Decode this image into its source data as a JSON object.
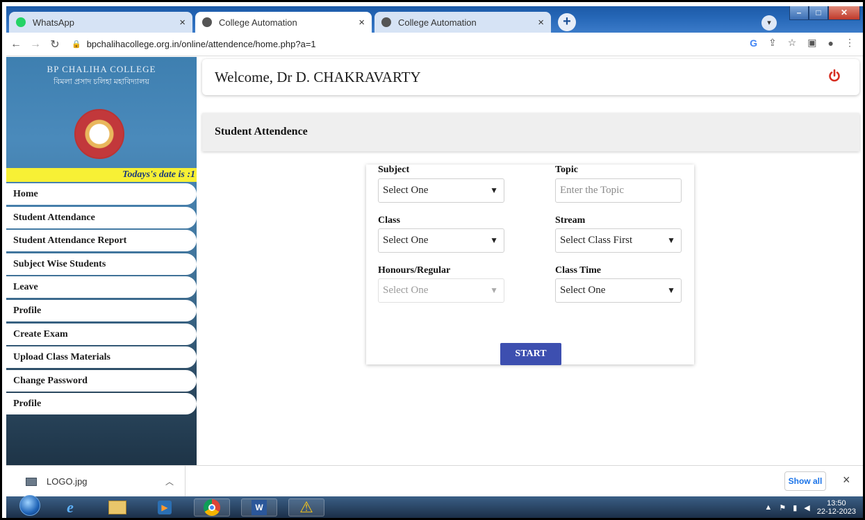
{
  "browser": {
    "tabs": [
      {
        "label": "WhatsApp",
        "favicon_color": "#25d366",
        "active": false
      },
      {
        "label": "College Automation",
        "favicon_color": "#555555",
        "active": true
      },
      {
        "label": "College Automation",
        "favicon_color": "#555555",
        "active": false
      }
    ],
    "url": "bpchalihacollege.org.in/online/attendence/home.php?a=1",
    "new_tab_symbol": "+",
    "close_symbol": "×"
  },
  "sidebar": {
    "college_name": "BP CHALIHA COLLEGE",
    "college_name_local": "বিমলা প্ৰসাদ চলিহা মহাবিদ্যালয়",
    "ticker": "Todays's date is :1",
    "items": [
      {
        "label": "Home"
      },
      {
        "label": "Student Attendance"
      },
      {
        "label": "Student Attendance Report"
      },
      {
        "label": "Subject Wise Students"
      },
      {
        "label": "Leave"
      },
      {
        "label": "Profile"
      },
      {
        "label": "Create Exam"
      },
      {
        "label": "Upload Class Materials"
      },
      {
        "label": "Change Password"
      },
      {
        "label": "Profile"
      }
    ]
  },
  "header": {
    "welcome": "Welcome, Dr D. CHAKRAVARTY",
    "power_color": "#d62d20"
  },
  "section": {
    "title": "Student Attendence"
  },
  "form": {
    "subject_label": "Subject",
    "subject_value": "Select One",
    "topic_label": "Topic",
    "topic_placeholder": "Enter the Topic",
    "class_label": "Class",
    "class_value": "Select One",
    "stream_label": "Stream",
    "stream_value": "Select Class First",
    "honours_label": "Honours/Regular",
    "honours_value": "Select One",
    "class_time_label": "Class Time",
    "class_time_value": "Select One",
    "start_label": "START",
    "accent": "#3d4fb0"
  },
  "downloads": {
    "file": "LOGO.jpg",
    "show_all": "Show all",
    "close_symbol": "×"
  },
  "taskbar": {
    "time": "13:50",
    "date": "22-12-2023"
  }
}
